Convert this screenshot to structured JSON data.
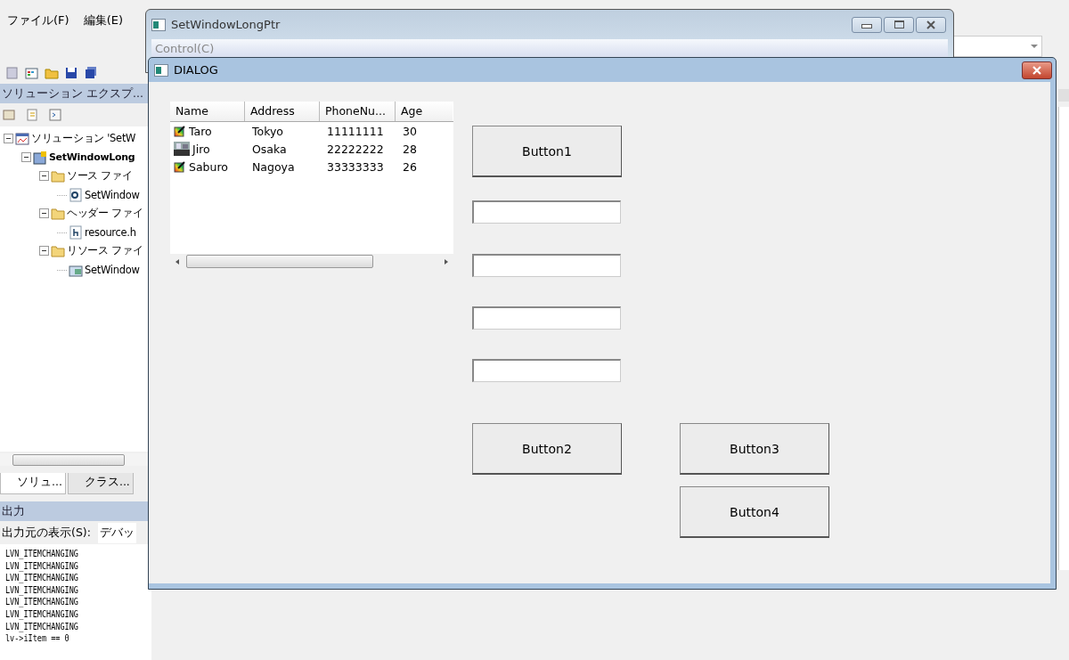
{
  "ide": {
    "menu": [
      "ファイル(F)",
      "編集(E)"
    ],
    "explorer": {
      "title": "ソリューション エクスプ...",
      "tree": [
        {
          "label": "ソリューション 'SetW",
          "kind": "solution",
          "expanded": true,
          "children": [
            {
              "label": "SetWindowLong",
              "kind": "project",
              "bold": true,
              "expanded": true,
              "children": [
                {
                  "label": "ソース ファイ",
                  "kind": "folder",
                  "expanded": true,
                  "children": [
                    {
                      "label": "SetWindow",
                      "kind": "cpp"
                    }
                  ]
                },
                {
                  "label": "ヘッダー ファイ",
                  "kind": "folder",
                  "expanded": true,
                  "children": [
                    {
                      "label": "resource.h",
                      "kind": "header"
                    }
                  ]
                },
                {
                  "label": "リソース ファイ",
                  "kind": "folder",
                  "expanded": true,
                  "children": [
                    {
                      "label": "SetWindow",
                      "kind": "resource"
                    }
                  ]
                }
              ]
            }
          ]
        }
      ]
    },
    "tabs": [
      {
        "label": "ソリュ...",
        "selected": true
      },
      {
        "label": "クラス...",
        "selected": false
      }
    ],
    "output": {
      "title": "出力",
      "source_label": "出力元の表示(S):",
      "source_value": "デバッ",
      "lines": [
        "LVN_ITEMCHANGING",
        "LVN_ITEMCHANGING",
        "LVN_ITEMCHANGING",
        "LVN_ITEMCHANGING",
        "LVN_ITEMCHANGING",
        "LVN_ITEMCHANGING",
        "LVN_ITEMCHANGING",
        "lv->iItem == 0"
      ]
    }
  },
  "main_window": {
    "title": "SetWindowLongPtr",
    "menu": [
      "Control(C)"
    ]
  },
  "dialog": {
    "title": "DIALOG",
    "list": {
      "columns": [
        "Name",
        "Address",
        "PhoneNu...",
        "Age"
      ],
      "rows": [
        {
          "kind": "pencil",
          "cells": [
            "Taro",
            "Tokyo",
            "11111111",
            "30"
          ]
        },
        {
          "cells": [
            "Jiro",
            "Osaka",
            "22222222",
            "28"
          ]
        },
        {
          "kind": "pencil",
          "cells": [
            "Saburo",
            "Nagoya",
            "33333333",
            "26"
          ]
        }
      ]
    },
    "buttons": [
      "Button1",
      "Button2",
      "Button3",
      "Button4"
    ],
    "fields": [
      {
        "kind": "edit"
      },
      {
        "kind": "edit"
      },
      {
        "kind": "edit"
      },
      {
        "kind": "edit"
      }
    ]
  }
}
